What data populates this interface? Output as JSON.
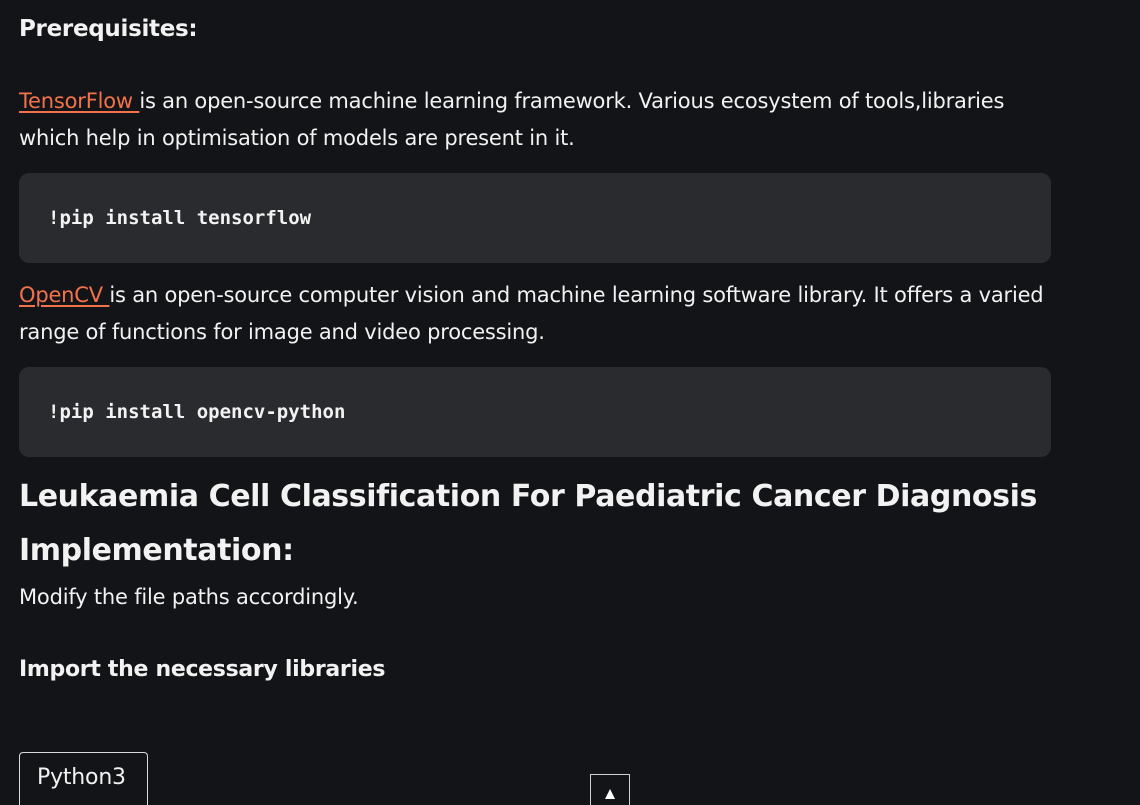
{
  "prerequisites": {
    "heading": "Prerequisites:",
    "items": [
      {
        "link_text": "TensorFlow ",
        "description": "is an open-source machine learning framework. Various ecosystem of tools,libraries which help in optimisation of models are present in it.",
        "code": "!pip install tensorflow"
      },
      {
        "link_text": "OpenCV ",
        "description": "is an open-source computer vision and machine learning software library. It offers a varied range of functions for image and video processing.",
        "code": "!pip install opencv-python"
      }
    ]
  },
  "article": {
    "title": "Leukaemia Cell Classification For Paediatric Cancer Diagnosis",
    "implementation_heading": "Implementation:",
    "implementation_text": "Modify the file paths accordingly.",
    "import_heading": "Import the necessary libraries"
  },
  "code_tabs": {
    "active_language": "Python3"
  },
  "scroll_top": {
    "icon": "up-triangle-icon",
    "glyph": "▲"
  },
  "colors": {
    "background": "#131417",
    "code_background": "#2a2b2f",
    "link": "#f2734b",
    "text": "#f2f2f2"
  }
}
